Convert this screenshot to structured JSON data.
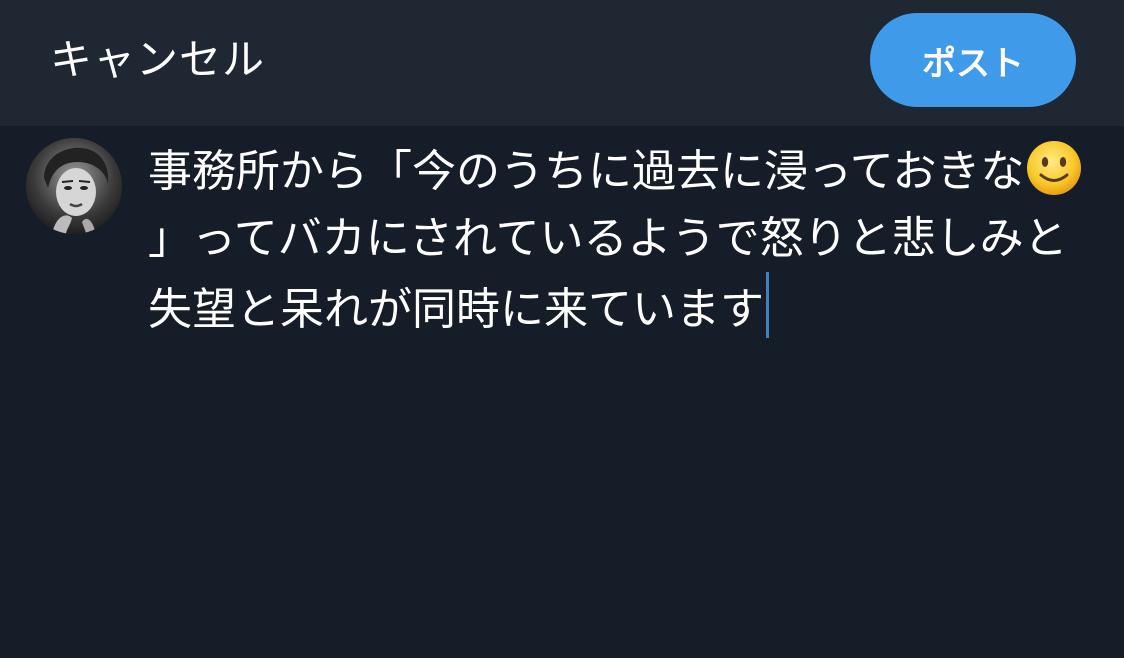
{
  "header": {
    "cancel_label": "キャンセル",
    "post_label": "ポスト",
    "accent_color": "#3f9bea",
    "background_color": "#1f2733"
  },
  "composer": {
    "text_before_emoji": "事務所から「今のうちに過去に浸っておきな",
    "emoji": "slightly-smiling-face",
    "text_after_emoji": "」ってバカにされているようで怒りと悲しみと失望と呆れが同時に来ています",
    "background_color": "#151d28"
  },
  "avatar": {
    "icon": "user-avatar-photo"
  }
}
